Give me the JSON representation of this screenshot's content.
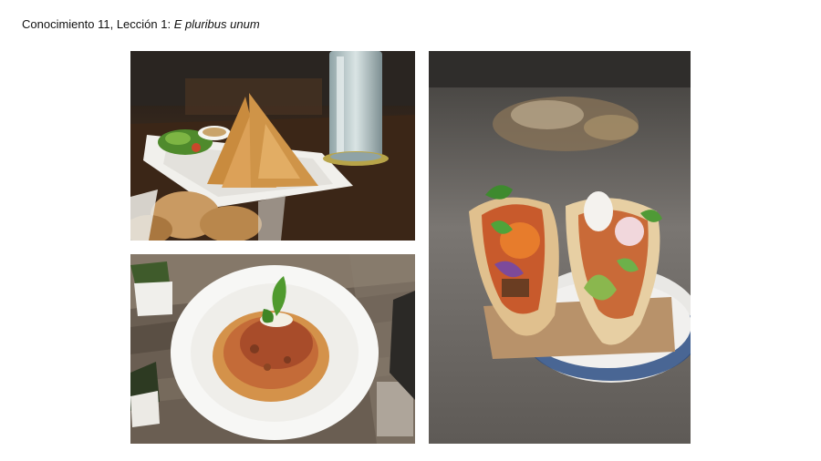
{
  "slide": {
    "title_prefix": "Conocimiento 11, Lección 1: ",
    "title_italic": "E pluribus unum"
  },
  "photos": [
    {
      "subject": "samosas-plate-with-water-glass"
    },
    {
      "subject": "spaghetti-bolognese-with-basil"
    },
    {
      "subject": "two-tacos-on-plate"
    }
  ],
  "colors": {
    "background": "#ffffff",
    "title_text": "#111111"
  }
}
